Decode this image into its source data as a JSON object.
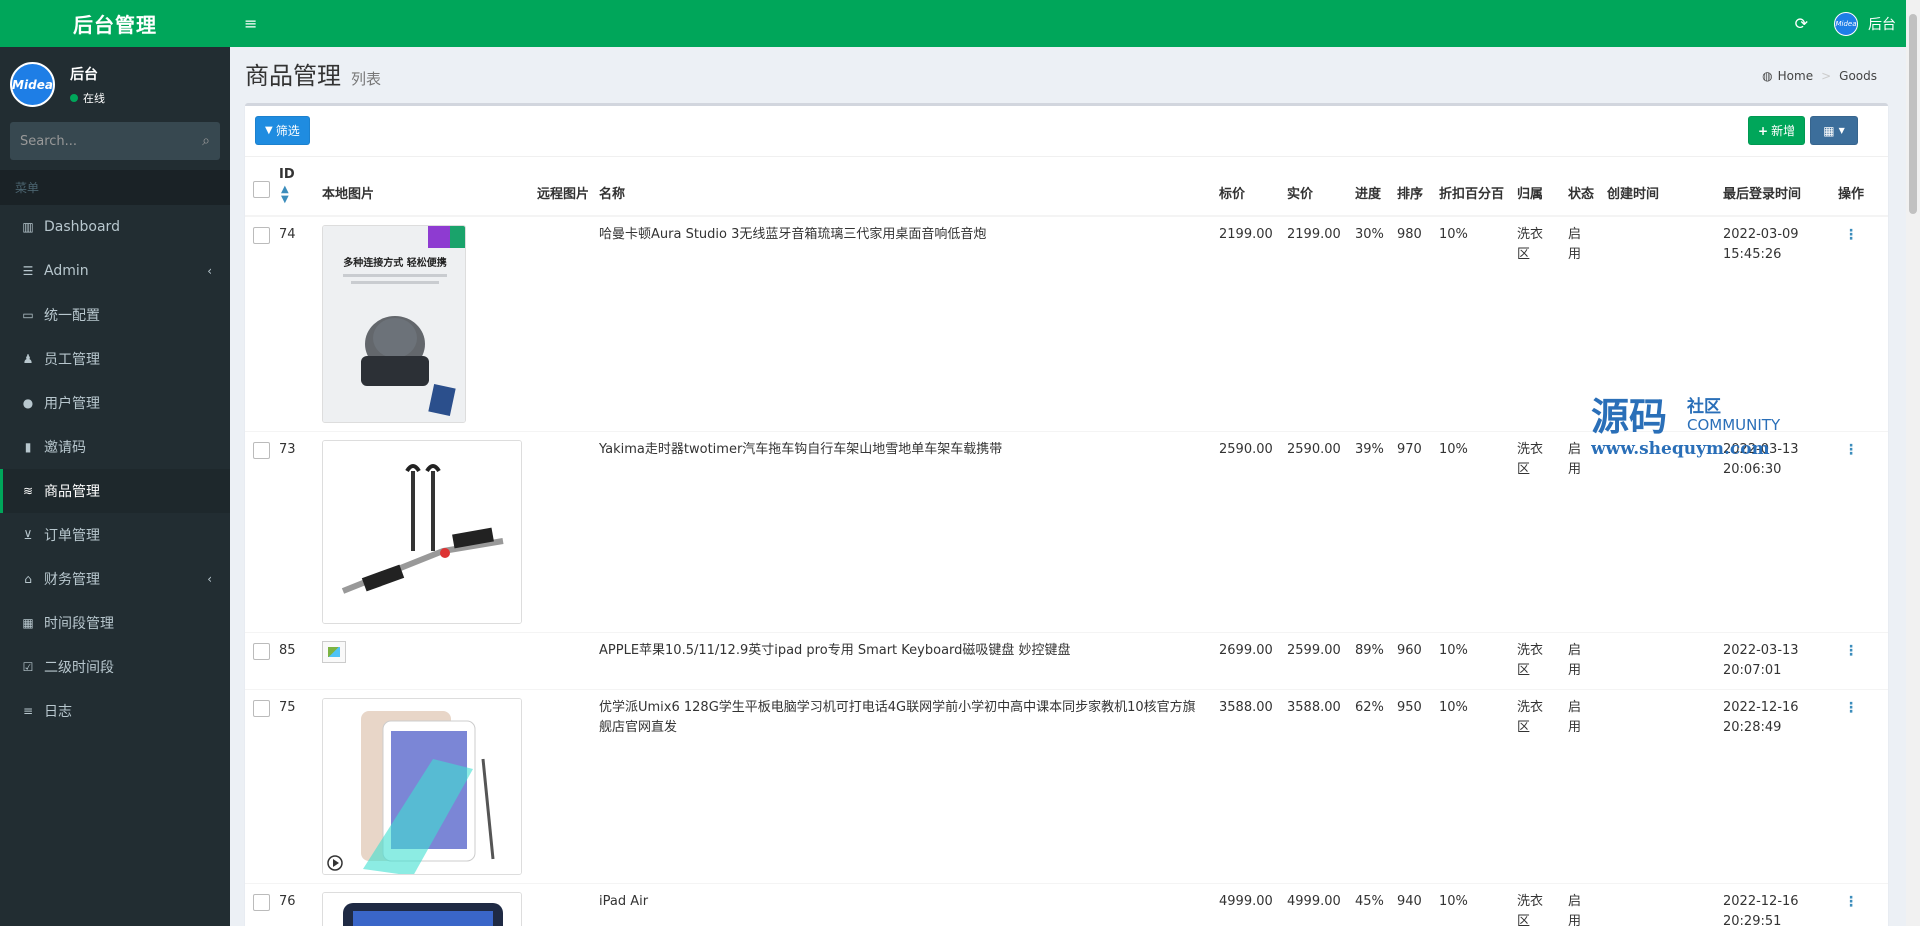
{
  "app": {
    "logo": "后台管理",
    "avatar_text": "Midea",
    "user_name": "后台",
    "user_status": "在线",
    "search_placeholder": "Search...",
    "menu_header": "菜单",
    "top_user": "后台"
  },
  "sidebar": {
    "items": [
      {
        "label": "Dashboard",
        "icon": "bar-chart-icon",
        "glyph": "▥"
      },
      {
        "label": "Admin",
        "icon": "list-icon",
        "glyph": "☰",
        "chevron": "‹"
      },
      {
        "label": "统一配置",
        "icon": "monitor-icon",
        "glyph": "▭"
      },
      {
        "label": "员工管理",
        "icon": "person-icon",
        "glyph": "♟"
      },
      {
        "label": "用户管理",
        "icon": "user-icon",
        "glyph": "●"
      },
      {
        "label": "邀请码",
        "icon": "book-icon",
        "glyph": "▮"
      },
      {
        "label": "商品管理",
        "icon": "database-icon",
        "glyph": "≋"
      },
      {
        "label": "订单管理",
        "icon": "cart-icon",
        "glyph": "⊻"
      },
      {
        "label": "财务管理",
        "icon": "bank-icon",
        "glyph": "⌂",
        "chevron": "‹"
      },
      {
        "label": "时间段管理",
        "icon": "calendar-icon",
        "glyph": "▦"
      },
      {
        "label": "二级时间段",
        "icon": "calendar-check-icon",
        "glyph": "☑"
      },
      {
        "label": "日志",
        "icon": "list-alt-icon",
        "glyph": "≡"
      }
    ],
    "active_index": 6
  },
  "header": {
    "title": "商品管理",
    "subtitle": "列表",
    "breadcrumb": [
      "Home",
      "Goods"
    ]
  },
  "toolbar": {
    "filter_label": "筛选",
    "add_label": "新增"
  },
  "table": {
    "columns": [
      "ID",
      "本地图片",
      "远程图片",
      "名称",
      "标价",
      "实价",
      "进度",
      "排序",
      "折扣百分百",
      "归属",
      "状态",
      "创建时间",
      "最后登录时间",
      "操作"
    ],
    "rows": [
      {
        "id": "74",
        "name": "哈曼卡顿Aura Studio 3无线蓝牙音箱琉璃三代家用桌面音响低音炮",
        "list_price": "2199.00",
        "real_price": "2199.00",
        "progress": "30%",
        "sort": "980",
        "discount": "10%",
        "belong": "洗衣区",
        "status": "启用",
        "created": "",
        "last_login": "2022-03-09 15:45:26",
        "image": "speaker",
        "image_caption": "多种连接方式 轻松便携"
      },
      {
        "id": "73",
        "name": "Yakima走时器twotimer汽车拖车钩自行车架山地雪地单车架车载携带",
        "list_price": "2590.00",
        "real_price": "2590.00",
        "progress": "39%",
        "sort": "970",
        "discount": "10%",
        "belong": "洗衣区",
        "status": "启用",
        "created": "",
        "last_login": "2022-03-13 20:06:30",
        "image": "bike-rack"
      },
      {
        "id": "85",
        "name": "APPLE苹果10.5/11/12.9英寸ipad pro专用 Smart Keyboard磁吸键盘 妙控键盘",
        "list_price": "2699.00",
        "real_price": "2599.00",
        "progress": "89%",
        "sort": "960",
        "discount": "10%",
        "belong": "洗衣区",
        "status": "启用",
        "created": "",
        "last_login": "2022-03-13 20:07:01",
        "image": "broken"
      },
      {
        "id": "75",
        "name": "优学派Umix6 128G学生平板电脑学习机可打电话4G联网学前小学初中高中课本同步家教机10核官方旗舰店官网直发",
        "list_price": "3588.00",
        "real_price": "3588.00",
        "progress": "62%",
        "sort": "950",
        "discount": "10%",
        "belong": "洗衣区",
        "status": "启用",
        "created": "",
        "last_login": "2022-12-16 20:28:49",
        "image": "tablet"
      },
      {
        "id": "76",
        "name": "iPad Air",
        "list_price": "4999.00",
        "real_price": "4999.00",
        "progress": "45%",
        "sort": "940",
        "discount": "10%",
        "belong": "洗衣区",
        "status": "启用",
        "created": "",
        "last_login": "2022-12-16 20:29:51",
        "image": "ipad"
      }
    ]
  },
  "watermark": {
    "main": "源码",
    "side": "社区",
    "community": "COMMUNITY",
    "url": "www.shequym.com"
  }
}
